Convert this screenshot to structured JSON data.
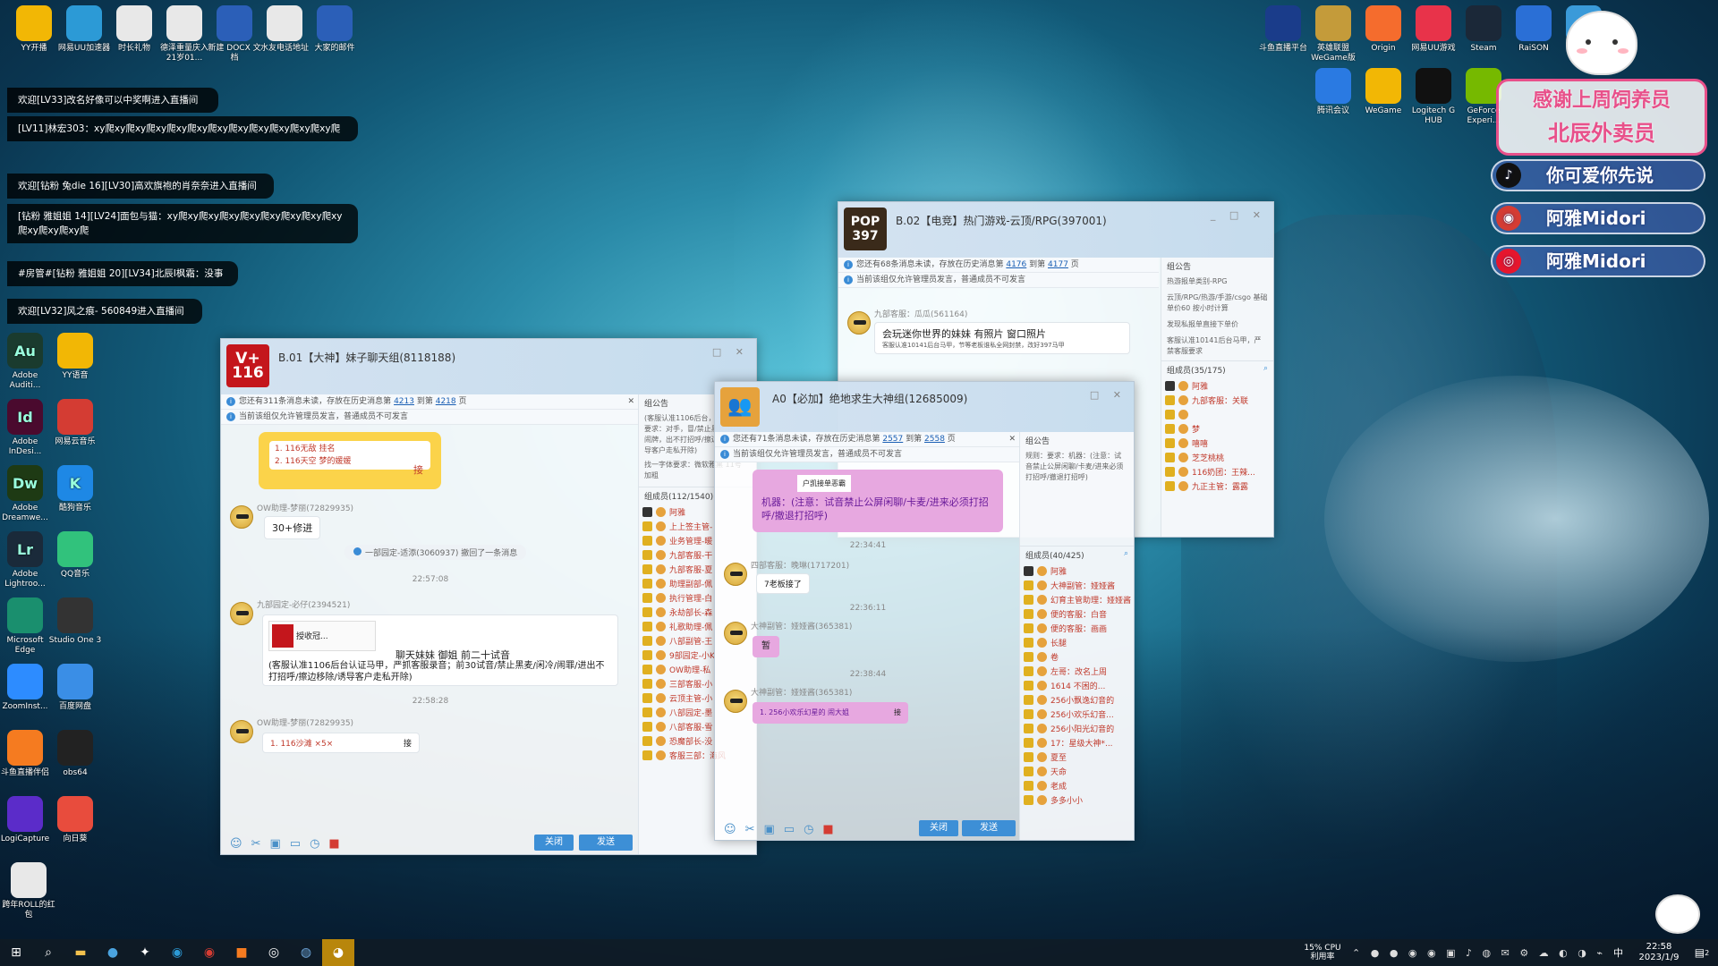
{
  "colors": {
    "accent": "#3d8fd6",
    "danmaku_bg": "#000000",
    "level": "#ffb347",
    "member_red": "#c0392b"
  },
  "desktop_top_icons": [
    {
      "label": "YY开播",
      "icon": "yy-icon",
      "color": "#f2b705"
    },
    {
      "label": "网易UU加速器",
      "icon": "uu-icon",
      "color": "#2c9ad6"
    },
    {
      "label": "时长礼物",
      "icon": "file-icon",
      "color": "#e8e8e8"
    },
    {
      "label": "德泽重量庆入21岁01...",
      "icon": "file-icon",
      "color": "#e8e8e8"
    },
    {
      "label": "新建 DOCX 文档",
      "icon": "word-icon",
      "color": "#2b5fb8"
    },
    {
      "label": "水友电话地址",
      "icon": "file-icon",
      "color": "#e8e8e8"
    },
    {
      "label": "大家的邮件",
      "icon": "word-icon",
      "color": "#2b5fb8"
    }
  ],
  "desktop_left_icons": [
    {
      "label": "Adobe Auditi...",
      "icon": "Au",
      "color": "#1a3b2e"
    },
    {
      "label": "YY语音",
      "icon": "yy-icon",
      "color": "#f2b705"
    },
    {
      "label": "Adobe InDesi...",
      "icon": "Id",
      "color": "#4a0a2e"
    },
    {
      "label": "网易云音乐",
      "icon": "netease-music-icon",
      "color": "#d43c33"
    },
    {
      "label": "Adobe Dreamwe...",
      "icon": "Dw",
      "color": "#1e3a14"
    },
    {
      "label": "酷狗音乐",
      "icon": "K",
      "color": "#1e88e5"
    },
    {
      "label": "Adobe Lightroo...",
      "icon": "Lr",
      "color": "#1a2a3a"
    },
    {
      "label": "QQ音乐",
      "icon": "qq-music-icon",
      "color": "#31c27c"
    },
    {
      "label": "Microsoft Edge",
      "icon": "edge-icon",
      "color": "#1a8f6e"
    },
    {
      "label": "Studio One 3",
      "icon": "studio-one-icon",
      "color": "#333333"
    },
    {
      "label": "ZoomInst...",
      "icon": "zoom-icon",
      "color": "#2d8cff"
    },
    {
      "label": "百度网盘",
      "icon": "baidu-pan-icon",
      "color": "#3a8ee6"
    },
    {
      "label": "斗鱼直播伴侣",
      "icon": "douyu-icon",
      "color": "#f57b20"
    },
    {
      "label": "obs64",
      "icon": "obs-icon",
      "color": "#222222"
    },
    {
      "label": "LogiCapture",
      "icon": "logi-icon",
      "color": "#5b2cc9"
    },
    {
      "label": "向日葵",
      "icon": "sunflower-icon",
      "color": "#e84c3d"
    },
    {
      "label": "跨年ROLL的红包",
      "icon": "file-icon",
      "color": "#e8e8e8"
    }
  ],
  "desktop_right_icons": [
    {
      "label": "斗鱼直播平台",
      "icon": "douyu-icon",
      "color": "#1a3c8a"
    },
    {
      "label": "英雄联盟WeGame版",
      "icon": "lol-icon",
      "color": "#c49b3a"
    },
    {
      "label": "Origin",
      "icon": "origin-icon",
      "color": "#f56c2d"
    },
    {
      "label": "网易UU游戏",
      "icon": "uu-game-icon",
      "color": "#e8334a"
    },
    {
      "label": "Steam",
      "icon": "steam-icon",
      "color": "#1b2838"
    },
    {
      "label": "RaiSON",
      "icon": "raison-icon",
      "color": "#2a6fd6"
    },
    {
      "label": "此电脑",
      "icon": "computer-icon",
      "color": "#3a9ad9"
    },
    {
      "label": "腾讯会议",
      "icon": "tencent-meeting-icon",
      "color": "#2a7ae2"
    },
    {
      "label": "WeGame",
      "icon": "wegame-icon",
      "color": "#f2b705"
    },
    {
      "label": "Logitech G HUB",
      "icon": "ghub-icon",
      "color": "#111111"
    },
    {
      "label": "GeForce Experi...",
      "icon": "geforce-icon",
      "color": "#76b900"
    }
  ],
  "danmaku": [
    {
      "text": "欢迎[LV33]改名好像可以中奖啊进入直播间"
    },
    {
      "text": "[LV11]林宏303：xy爬xy爬xy爬xy爬xy爬xy爬xy爬xy爬xy爬xy爬xy爬xy爬"
    },
    {
      "text": "欢迎[钻粉 兔die 16][LV30]高欢旗袍的肖奈奈进入直播间"
    },
    {
      "text": "[钻粉 雅姐姐 14][LV24]面包与猫：xy爬xy爬xy爬xy爬xy爬xy爬xy爬xy爬xy爬xy爬xy爬xy爬"
    },
    {
      "text": "#房管#[钻粉 雅姐姐 20][LV34]北辰I枫霜：没事"
    },
    {
      "text": "欢迎[LV32]风之痕- 560849进入直播间"
    }
  ],
  "overlay": {
    "thanks_line1": "感谢上周饲养员",
    "thanks_line2": "北辰外卖员",
    "rows": [
      {
        "icon": "douyin-icon",
        "text": "你可爱你先说",
        "bg": "#111111"
      },
      {
        "icon": "netease-music-icon",
        "text": "阿雅Midori",
        "bg": "#d43c33"
      },
      {
        "icon": "weibo-icon",
        "text": "阿雅Midori",
        "bg": "#e6162d"
      }
    ]
  },
  "win_b01": {
    "logo_text": "V+ 116",
    "title": "B.01【大神】妹子聊天组(8118188)",
    "notice1_pre": "您还有311条消息未读，存放在历史消息第",
    "notice1_a": "4213",
    "notice1_mid": "到第",
    "notice1_b": "4218",
    "notice1_post": "页",
    "notice2": "当前该组仅允许管理员发言，普通成员不可发言",
    "side_header": "组公告",
    "side_notice": "(客服认准1106后台，严禁客服要求：对手，冒/禁止黑麦/闲冷/闹牌，出不打招呼/擦边移除，诱导客户走私开除)",
    "side_extra": "找一字体要求：微软雅黑 11号 加粗",
    "members_header": "组成员(112/1540)",
    "members": [
      "阿雅",
      "上上签主管-",
      "业务管理-暖",
      "九部客服-干",
      "九部客服-夏",
      "助理副部-佩",
      "执行管理-白",
      "永劫部长-森",
      "礼歌助理-佩",
      "八部副管-王",
      "9部园定-小K",
      "OW助理-私",
      "三部客服-小",
      "云顶主管-小",
      "八部园定-墨",
      "八部客服-雪",
      "恐魔部长-没",
      "客服三部：海风"
    ],
    "msg_join_line1": "1. 116无敌 挂名",
    "msg_join_line2": "2. 116天空 梦的媛媛",
    "msg_join_tag": "接",
    "m1_name": "OW助理-梦丽(72829935)",
    "m1_text": "30+修进",
    "recall": "一部园定-适添(3060937) 撤回了一条消息",
    "t1": "22:57:08",
    "m2_name": "九部园定-必仔(2394521)",
    "m2_card": "授收冠...",
    "m2_text1": "聊天妹妹 御姐 前二十试音",
    "m2_text2": "(客服认准1106后台认证马甲，严抓客服录音；前30试音/禁止黑麦/闲冷/闹罪/进出不打招呼/擦边移除/诱导客户走私开除)",
    "t2": "22:58:28",
    "m3_name": "OW助理-梦丽(72829935)",
    "m3_text": "1. 116沙滩 ×5×",
    "m3_tag": "接",
    "btn_close": "关闭",
    "btn_send": "发送"
  },
  "win_b02": {
    "logo_text": "POP 397",
    "title": "B.02【电竞】热门游戏-云顶/RPG(397001)",
    "notice1_pre": "您还有68条消息未读，存放在历史消息第",
    "notice1_a": "4176",
    "notice1_mid": "到第",
    "notice1_b": "4177",
    "notice1_post": "页",
    "notice2": "当前该组仅允许管理员发言，普通成员不可发言",
    "side_header": "组公告",
    "side_l1": "热游报单类别-RPG",
    "side_l2": "云顶/RPG/热游/手游/csgo 基础单价60 按小时计算",
    "side_l3": "发现私报单直接下单价",
    "side_l4": "客服认准10141后台马甲，严禁客服要求",
    "m_name": "九部客服：瓜瓜(561164)",
    "m_text": "会玩迷你世界的妹妹 有照片 窗口照片",
    "m_sub": "客服认准10141后台马甲，节等老板谁私全网封禁，改好397马甲",
    "members_header": "组成员(35/175)",
    "members": [
      "阿雅",
      "九部客服：关联",
      "",
      "梦",
      "嘻嘻",
      "芝芝桃桃",
      "116奶团：王辣...",
      "九正主管：露露"
    ]
  },
  "win_a0": {
    "title": "A0【必加】绝地求生大神组(12685009)",
    "notice1_pre": "您还有71条消息未读，存放在历史消息第",
    "notice1_a": "2557",
    "notice1_mid": "到第",
    "notice1_b": "2558",
    "notice1_post": "页",
    "notice2": "当前该组仅允许管理员发言，普通成员不可发言",
    "side_header": "组公告",
    "side_text": "规则：要求：机器：(注意：试音禁止公屏闲聊/卡麦/进来必须打招呼/撤退打招呼)",
    "pink_card": "户凯接单恶霸",
    "pink_text": "机器：(注意：试音禁止公屏闲聊/卡麦/进来必须打招呼/撤退打招呼)",
    "t1": "22:34:41",
    "m1_name": "四部客服：晚琳(1717201)",
    "m1_text": "7老板接了",
    "t2": "22:36:11",
    "m2_name": "大神副管：娅娅酱(365381)",
    "m2_text": "暂",
    "t3": "22:38:44",
    "m3_name": "大神副管：娅娅酱(365381)",
    "m3_text": "1. 256小欢乐幻星的 闹大姐",
    "m3_tag": "接",
    "members_header": "组成员(40/425)",
    "members": [
      "阿雅",
      "大神副管：娅娅酱",
      "幻育主管助理：娅娅酱",
      "便的客服：白音",
      "便的客服：画画",
      "长腿",
      "卷",
      "左哥：改名上周",
      "1614 不困的...",
      "256小飘逸幻音的",
      "256小欢乐幻音...",
      "256小阳光幻音的",
      "17：星级大神*...",
      "夏至",
      "天命",
      "老成",
      "多多小小"
    ],
    "btn_close": "关闭",
    "btn_send": "发送"
  },
  "taskbar": {
    "cpu_label": "15% CPU利用率",
    "time": "22:58",
    "date": "2023/1/9",
    "lang": "中",
    "notif_count": "2"
  }
}
